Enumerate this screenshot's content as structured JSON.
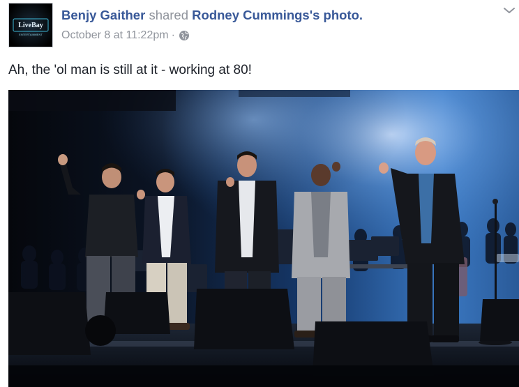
{
  "post": {
    "author_name": "Benjy Gaither",
    "shared_text": "shared",
    "source_name": "Rodney Cummings",
    "source_suffix": "'s photo.",
    "timestamp": "October 8 at 11:22pm",
    "separator": "·",
    "privacy_icon": "globe-icon",
    "menu_icon": "chevron-down-icon",
    "caption": "Ah, the 'ol man is still at it - working at 80!"
  },
  "avatar": {
    "logo_text": "LiveBay",
    "logo_subtext": "ENTERTAINMENT"
  },
  "photo": {
    "description_icon": "concert-photo",
    "colors": {
      "stage_light": "#3a78c2",
      "stage_dark": "#05070c",
      "spot_white": "#cfe3ff"
    }
  },
  "colors": {
    "link": "#385898",
    "muted": "#90949c",
    "text": "#1d2129"
  }
}
